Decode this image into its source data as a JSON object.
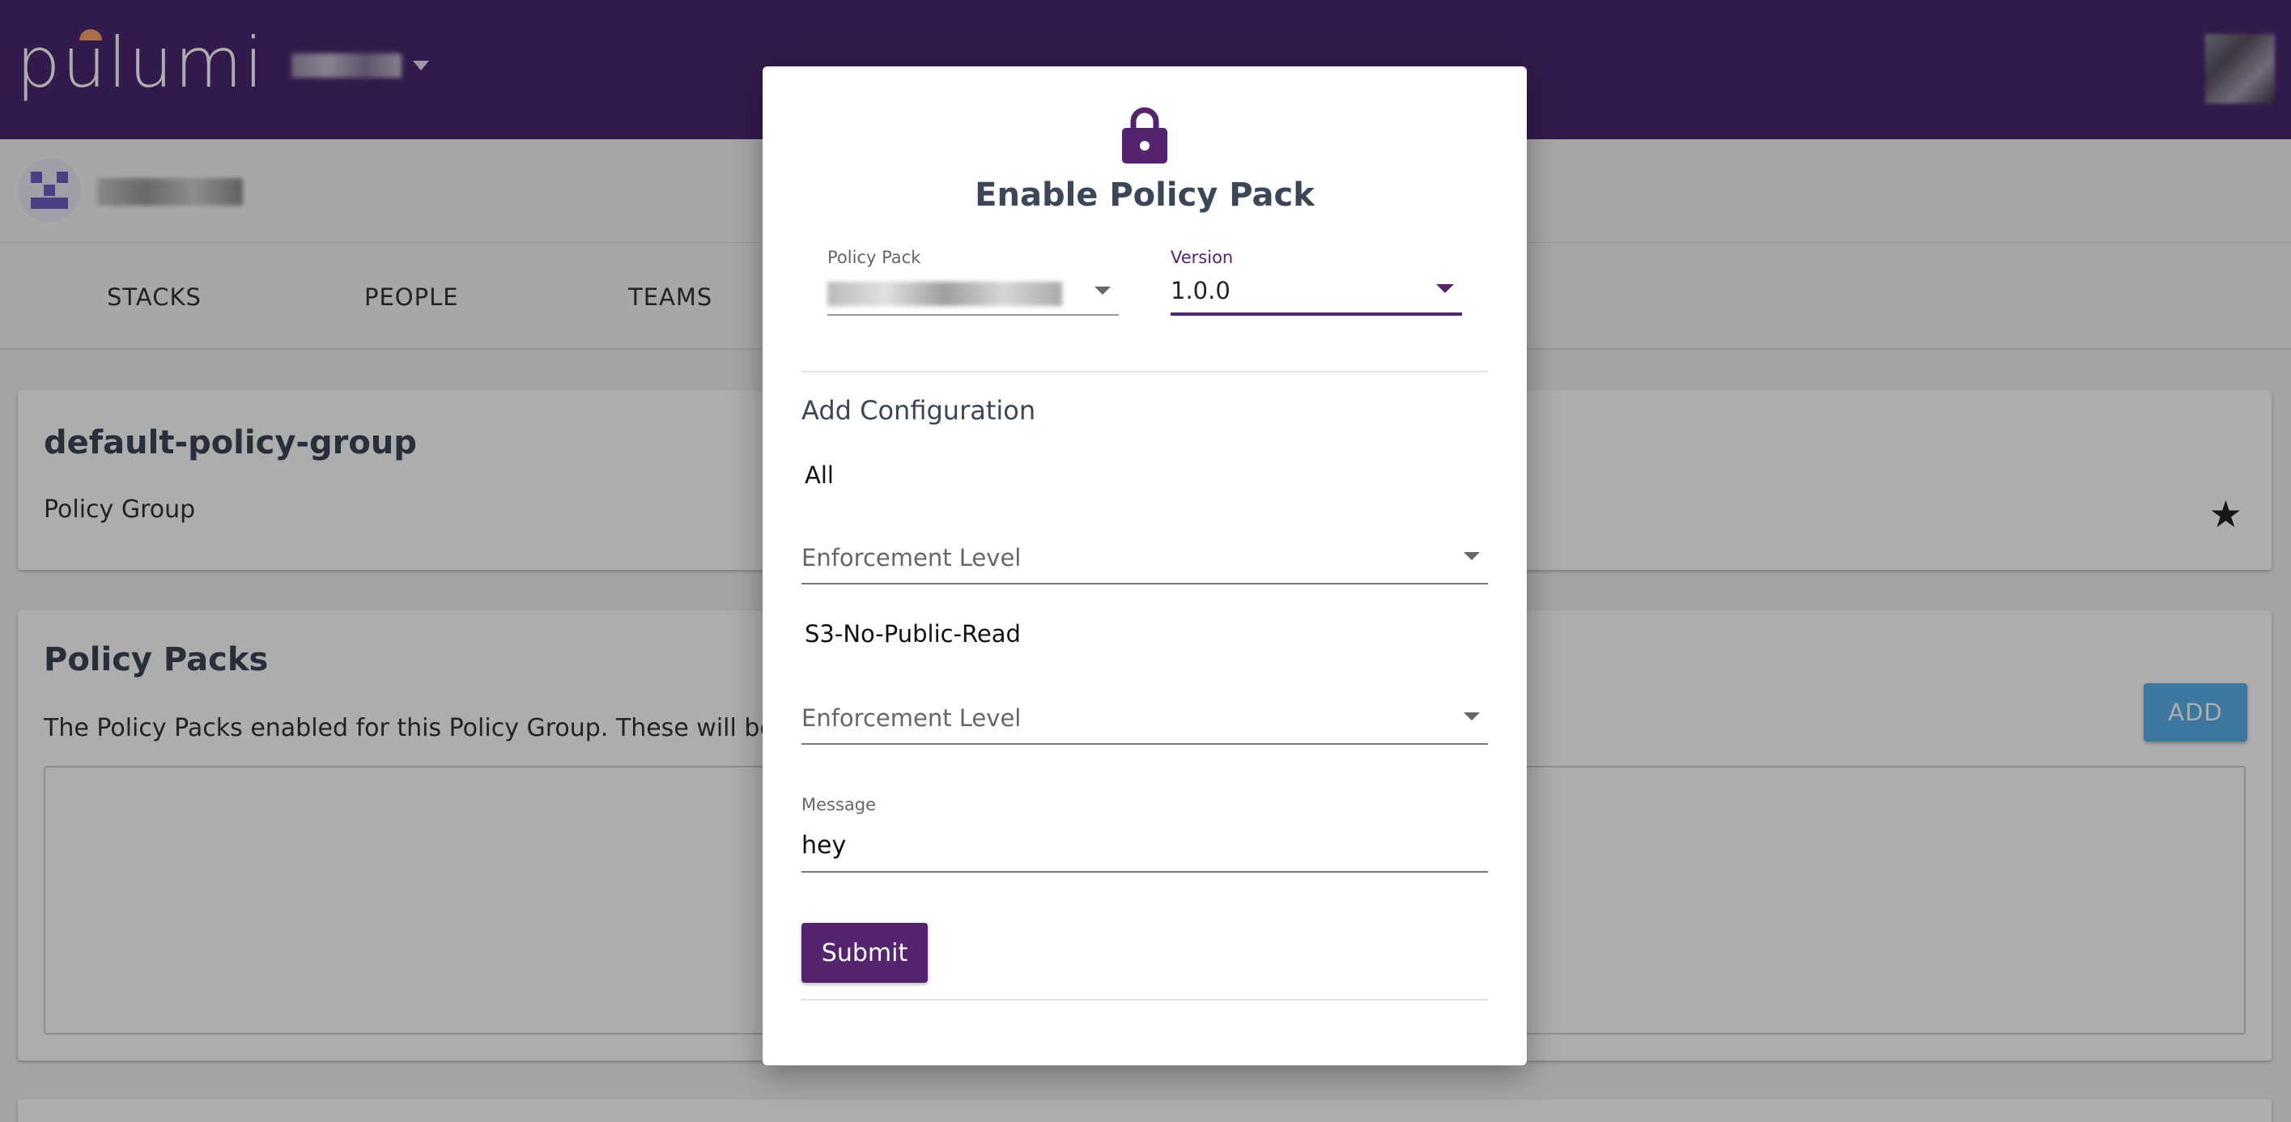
{
  "header": {
    "logo_text": "pulumi",
    "org_switcher_label": "",
    "accent_color": "#4a2870"
  },
  "nav": {
    "tabs": [
      {
        "label": "STACKS"
      },
      {
        "label": "PEOPLE"
      },
      {
        "label": "TEAMS"
      }
    ]
  },
  "policy_group": {
    "title": "default-policy-group",
    "subtitle": "Policy Group",
    "star_icon": "star-icon"
  },
  "policy_packs": {
    "title": "Policy Packs",
    "description": "The Policy Packs enabled for this Policy Group. These will be required",
    "add_label": "ADD"
  },
  "modal": {
    "icon": "lock-icon",
    "title": "Enable Policy Pack",
    "policy_pack_label": "Policy Pack",
    "policy_pack_value": "",
    "version_label": "Version",
    "version_value": "1.0.0",
    "config_heading": "Add Configuration",
    "policies": [
      {
        "name": "All",
        "enforcement_placeholder": "Enforcement Level"
      },
      {
        "name": "S3-No-Public-Read",
        "enforcement_placeholder": "Enforcement Level"
      }
    ],
    "message_label": "Message",
    "message_value": "hey",
    "submit_label": "Submit",
    "brand_color": "#54246e"
  }
}
